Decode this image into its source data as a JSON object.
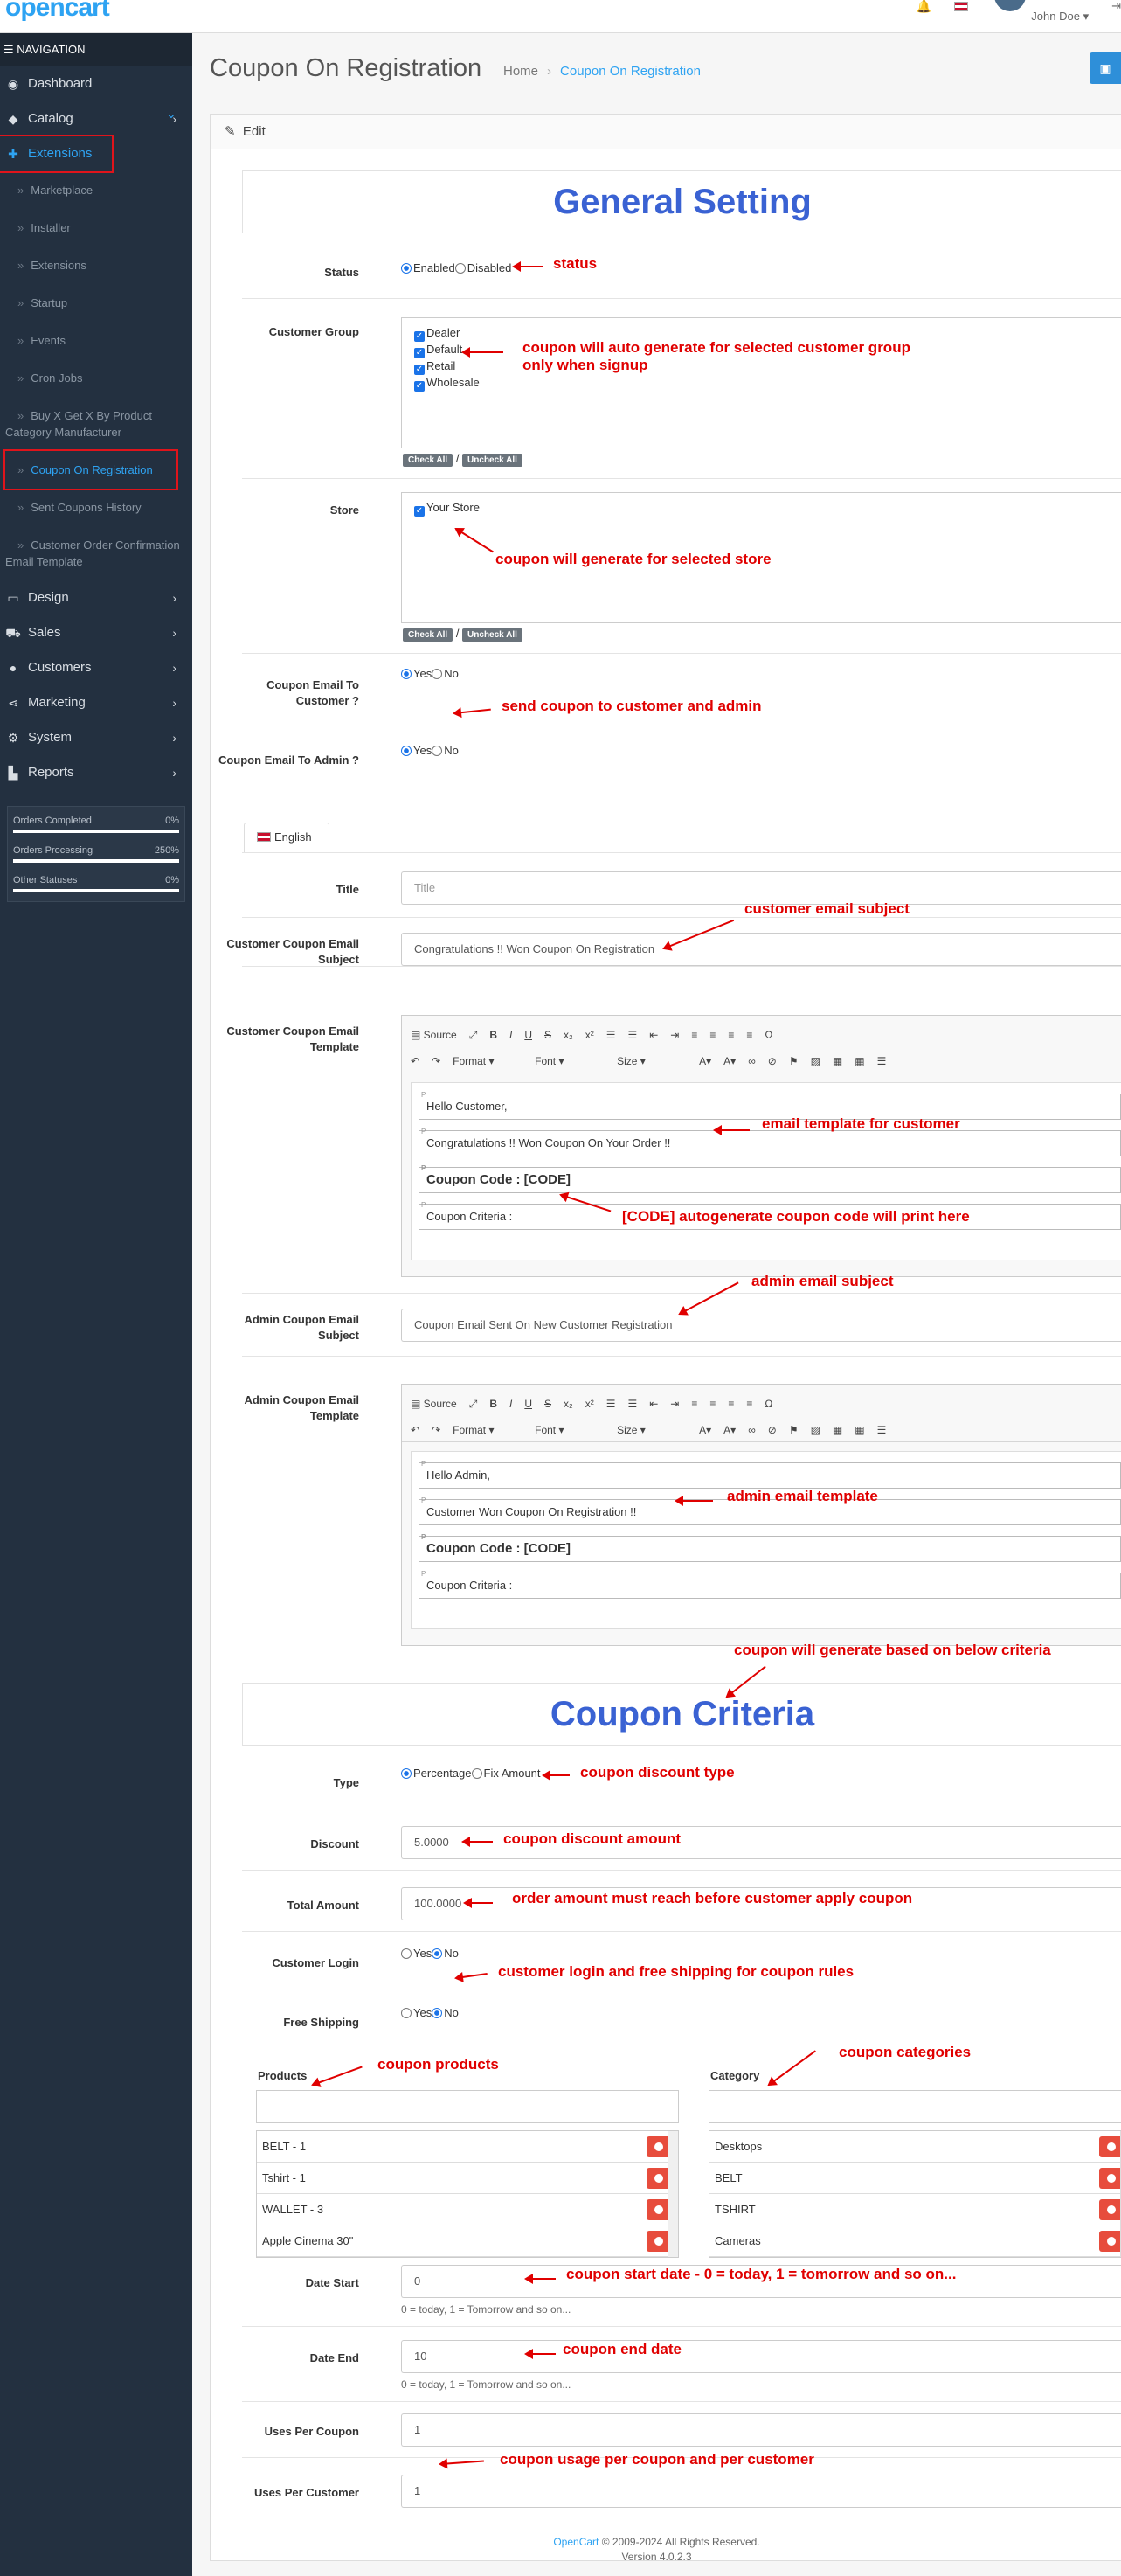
{
  "header": {
    "logo": "opencart",
    "user_name": "John Doe",
    "bell_icon": "bell-icon",
    "flag_icon": "uk-flag-icon",
    "logout_icon": "logout-icon"
  },
  "sidebar": {
    "nav_title": "NAVIGATION",
    "items": [
      {
        "label": "Dashboard",
        "icon": "dashboard-icon"
      },
      {
        "label": "Catalog",
        "icon": "tag-icon"
      },
      {
        "label": "Extensions",
        "icon": "puzzle-icon"
      },
      {
        "label": "Design",
        "icon": "monitor-icon"
      },
      {
        "label": "Sales",
        "icon": "cart-icon"
      },
      {
        "label": "Customers",
        "icon": "user-icon"
      },
      {
        "label": "Marketing",
        "icon": "share-icon"
      },
      {
        "label": "System",
        "icon": "gear-icon"
      },
      {
        "label": "Reports",
        "icon": "chart-icon"
      }
    ],
    "sub_items": [
      "Marketplace",
      "Installer",
      "Extensions",
      "Startup",
      "Events",
      "Cron Jobs",
      "Buy X Get X By Product Category Manufacturer",
      "Coupon On Registration",
      "Sent Coupons History",
      "Customer Order Confirmation Email Template"
    ],
    "stats": [
      {
        "label": "Orders Completed",
        "value": "0%",
        "fill": 1.0
      },
      {
        "label": "Orders Processing",
        "value": "250%",
        "fill": 1.0
      },
      {
        "label": "Other Statuses",
        "value": "0%",
        "fill": 1.0
      }
    ]
  },
  "page": {
    "title": "Coupon On Registration",
    "breadcrumb": [
      "Home",
      "Coupon On Registration"
    ],
    "panel_heading": "Edit",
    "general_title": "General Setting",
    "criteria_title": "Coupon Criteria"
  },
  "form": {
    "status": {
      "label": "Status",
      "options": [
        "Enabled",
        "Disabled"
      ]
    },
    "customer_group": {
      "label": "Customer Group",
      "options": [
        "Dealer",
        "Default",
        "Retail",
        "Wholesale"
      ],
      "check_all": "Check All",
      "uncheck_all": "Uncheck All"
    },
    "store": {
      "label": "Store",
      "options": [
        "Your Store"
      ],
      "check_all": "Check All",
      "uncheck_all": "Uncheck All"
    },
    "email_to_customer": {
      "label": "Coupon Email To Customer ?",
      "options": [
        "Yes",
        "No"
      ]
    },
    "email_to_admin": {
      "label": "Coupon Email To Admin ?",
      "options": [
        "Yes",
        "No"
      ]
    },
    "language_tab": "English",
    "title": {
      "label": "Title",
      "placeholder": "Title"
    },
    "customer_subject": {
      "label": "Customer Coupon Email Subject",
      "value": "Congratulations !! Won Coupon On Registration"
    },
    "customer_template": {
      "label": "Customer Coupon Email Template",
      "lines": [
        "Hello Customer,",
        "Congratulations !! Won Coupon On Your Order !!",
        "Coupon Code : [CODE]",
        "Coupon Criteria :"
      ]
    },
    "admin_subject": {
      "label": "Admin Coupon Email Subject",
      "value": "Coupon Email Sent On New Customer Registration"
    },
    "admin_template": {
      "label": "Admin Coupon Email Template",
      "lines": [
        "Hello Admin,",
        "Customer Won Coupon On Registration !!",
        "Coupon Code : [CODE]",
        "Coupon Criteria :"
      ]
    },
    "toolbar": {
      "source": "Source",
      "format": "Format",
      "font": "Font",
      "size": "Size"
    },
    "type": {
      "label": "Type",
      "options": [
        "Percentage",
        "Fix Amount"
      ]
    },
    "discount": {
      "label": "Discount",
      "value": "5.0000"
    },
    "total_amount": {
      "label": "Total Amount",
      "value": "100.0000"
    },
    "customer_login": {
      "label": "Customer Login",
      "options": [
        "Yes",
        "No"
      ]
    },
    "free_shipping": {
      "label": "Free Shipping",
      "options": [
        "Yes",
        "No"
      ]
    },
    "products": {
      "label": "Products",
      "items": [
        "BELT - 1",
        "Tshirt - 1",
        "WALLET - 3",
        "Apple Cinema 30\""
      ]
    },
    "category": {
      "label": "Category",
      "items": [
        "Desktops",
        "BELT",
        "TSHIRT",
        "Cameras"
      ]
    },
    "date_start": {
      "label": "Date Start",
      "value": "0",
      "help": "0 = today, 1 = Tomorrow and so on..."
    },
    "date_end": {
      "label": "Date End",
      "value": "10",
      "help": "0 = today, 1 = Tomorrow and so on..."
    },
    "uses_per_coupon": {
      "label": "Uses Per Coupon",
      "value": "1"
    },
    "uses_per_customer": {
      "label": "Uses Per Customer",
      "value": "1"
    }
  },
  "annotations": {
    "status": "status",
    "customer_group": "coupon will auto generate for selected customer group\nonly when signup",
    "store": "coupon will generate for selected store",
    "send": "send coupon to customer and admin",
    "cust_subject": "customer email subject",
    "cust_template": "email template for customer",
    "code": "[CODE] autogenerate coupon code will print here",
    "admin_subject": "admin email subject",
    "admin_template": "admin email template",
    "criteria": "coupon will generate based on below criteria",
    "type": "coupon discount type",
    "discount": "coupon discount amount",
    "total": "order amount must reach before customer apply coupon",
    "login": "customer login and free shipping for coupon rules",
    "products": "coupon products",
    "categories": "coupon categories",
    "start": "coupon start date - 0 = today, 1 = tomorrow and so on...",
    "end": "coupon end date",
    "uses": "coupon usage per coupon and per customer"
  },
  "footer": {
    "brand": "OpenCart",
    "copyright": " © 2009-2024 All Rights Reserved.",
    "version": "Version 4.0.2.3"
  }
}
